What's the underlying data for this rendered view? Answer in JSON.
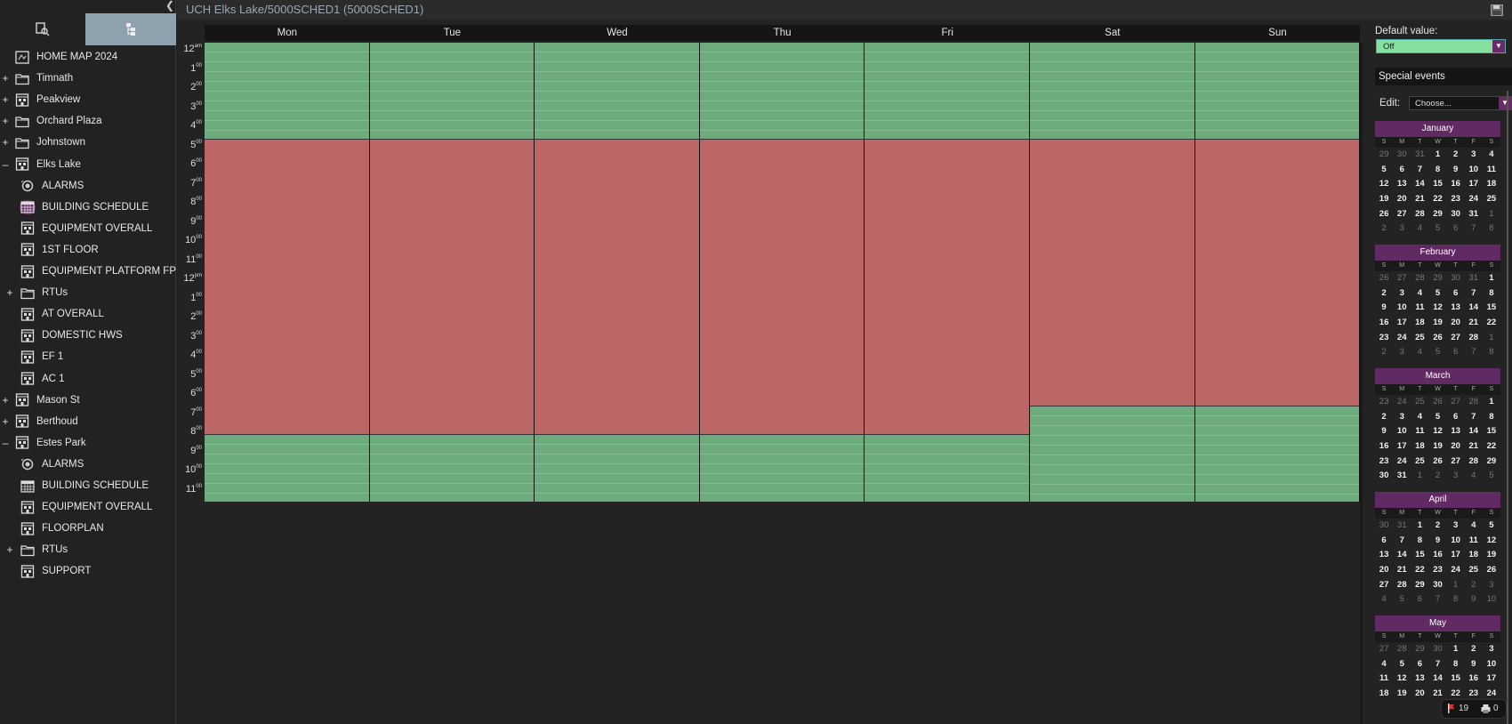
{
  "page_title": "UCH Elks Lake/5000SCHED1 (5000SCHED1)",
  "tree": [
    {
      "label": "HOME MAP 2024",
      "icon": "map-icon",
      "level": 0,
      "expander": ""
    },
    {
      "label": "Timnath",
      "icon": "folder-icon",
      "level": 0,
      "expander": "+"
    },
    {
      "label": "Peakview",
      "icon": "building-icon",
      "level": 0,
      "expander": "+"
    },
    {
      "label": "Orchard Plaza",
      "icon": "folder-icon",
      "level": 0,
      "expander": "+"
    },
    {
      "label": "Johnstown",
      "icon": "folder-icon",
      "level": 0,
      "expander": "+"
    },
    {
      "label": "Elks Lake",
      "icon": "building-icon",
      "level": 0,
      "expander": "–"
    },
    {
      "label": "ALARMS",
      "icon": "alarm-icon",
      "level": 1,
      "expander": ""
    },
    {
      "label": "BUILDING SCHEDULE",
      "icon": "calendar-icon",
      "level": 1,
      "expander": "",
      "selected": true
    },
    {
      "label": "EQUIPMENT OVERALL",
      "icon": "building-icon",
      "level": 1,
      "expander": ""
    },
    {
      "label": "1ST FLOOR",
      "icon": "building-icon",
      "level": 1,
      "expander": ""
    },
    {
      "label": "EQUIPMENT PLATFORM FP",
      "icon": "building-icon",
      "level": 1,
      "expander": ""
    },
    {
      "label": "RTUs",
      "icon": "folder-icon",
      "level": 1,
      "expander": "+"
    },
    {
      "label": "AT OVERALL",
      "icon": "building-icon",
      "level": 1,
      "expander": ""
    },
    {
      "label": "DOMESTIC HWS",
      "icon": "building-icon",
      "level": 1,
      "expander": ""
    },
    {
      "label": "EF 1",
      "icon": "building-icon",
      "level": 1,
      "expander": ""
    },
    {
      "label": "AC 1",
      "icon": "building-icon",
      "level": 1,
      "expander": ""
    },
    {
      "label": "Mason St",
      "icon": "building-icon",
      "level": 0,
      "expander": "+"
    },
    {
      "label": "Berthoud",
      "icon": "building-icon",
      "level": 0,
      "expander": "+"
    },
    {
      "label": "Estes Park",
      "icon": "building-icon",
      "level": 0,
      "expander": "–"
    },
    {
      "label": "ALARMS",
      "icon": "alarm-icon",
      "level": 1,
      "expander": ""
    },
    {
      "label": "BUILDING SCHEDULE",
      "icon": "calendar-icon",
      "level": 1,
      "expander": ""
    },
    {
      "label": "EQUIPMENT OVERALL",
      "icon": "building-icon",
      "level": 1,
      "expander": ""
    },
    {
      "label": "FLOORPLAN",
      "icon": "building-icon",
      "level": 1,
      "expander": ""
    },
    {
      "label": "RTUs",
      "icon": "folder-icon",
      "level": 1,
      "expander": "+"
    },
    {
      "label": "SUPPORT",
      "icon": "building-icon",
      "level": 1,
      "expander": ""
    }
  ],
  "schedule": {
    "days": [
      "Mon",
      "Tue",
      "Wed",
      "Thu",
      "Fri",
      "Sat",
      "Sun"
    ],
    "hours": [
      {
        "h": "12",
        "s": "am"
      },
      {
        "h": "1",
        "s": "00"
      },
      {
        "h": "2",
        "s": "00"
      },
      {
        "h": "3",
        "s": "00"
      },
      {
        "h": "4",
        "s": "00"
      },
      {
        "h": "5",
        "s": "00"
      },
      {
        "h": "6",
        "s": "00"
      },
      {
        "h": "7",
        "s": "00"
      },
      {
        "h": "8",
        "s": "00"
      },
      {
        "h": "9",
        "s": "00"
      },
      {
        "h": "10",
        "s": "00"
      },
      {
        "h": "11",
        "s": "00"
      },
      {
        "h": "12",
        "s": "pm"
      },
      {
        "h": "1",
        "s": "00"
      },
      {
        "h": "2",
        "s": "00"
      },
      {
        "h": "3",
        "s": "00"
      },
      {
        "h": "4",
        "s": "00"
      },
      {
        "h": "5",
        "s": "00"
      },
      {
        "h": "6",
        "s": "00"
      },
      {
        "h": "7",
        "s": "00"
      },
      {
        "h": "8",
        "s": "00"
      },
      {
        "h": "9",
        "s": "00"
      },
      {
        "h": "10",
        "s": "00"
      },
      {
        "h": "11",
        "s": "00"
      }
    ],
    "occupied": [
      {
        "day": "Mon",
        "start": 5,
        "end": 20.5
      },
      {
        "day": "Tue",
        "start": 5,
        "end": 20.5
      },
      {
        "day": "Wed",
        "start": 5,
        "end": 20.5
      },
      {
        "day": "Thu",
        "start": 5,
        "end": 20.5
      },
      {
        "day": "Fri",
        "start": 5,
        "end": 20.5
      },
      {
        "day": "Sat",
        "start": 5,
        "end": 19
      },
      {
        "day": "Sun",
        "start": 5,
        "end": 19
      }
    ],
    "colors": {
      "off": "#6eab7c",
      "on": "#bc6668"
    }
  },
  "right_panel": {
    "default_value_label": "Default value:",
    "default_value": "Off",
    "special_events_label": "Special events",
    "edit_label": "Edit:",
    "edit_placeholder": "Choose...",
    "dow": [
      "S",
      "M",
      "T",
      "W",
      "T",
      "F",
      "S"
    ],
    "months": [
      {
        "name": "January",
        "weeks": [
          [
            "29",
            "30",
            "31",
            "1",
            "2",
            "3",
            "4"
          ],
          [
            "5",
            "6",
            "7",
            "8",
            "9",
            "10",
            "11"
          ],
          [
            "12",
            "13",
            "14",
            "15",
            "16",
            "17",
            "18"
          ],
          [
            "19",
            "20",
            "21",
            "22",
            "23",
            "24",
            "25"
          ],
          [
            "26",
            "27",
            "28",
            "29",
            "30",
            "31",
            "1"
          ],
          [
            "2",
            "3",
            "4",
            "5",
            "6",
            "7",
            "8"
          ]
        ]
      },
      {
        "name": "February",
        "weeks": [
          [
            "26",
            "27",
            "28",
            "29",
            "30",
            "31",
            "1"
          ],
          [
            "2",
            "3",
            "4",
            "5",
            "6",
            "7",
            "8"
          ],
          [
            "9",
            "10",
            "11",
            "12",
            "13",
            "14",
            "15"
          ],
          [
            "16",
            "17",
            "18",
            "19",
            "20",
            "21",
            "22"
          ],
          [
            "23",
            "24",
            "25",
            "26",
            "27",
            "28",
            "1"
          ],
          [
            "2",
            "3",
            "4",
            "5",
            "6",
            "7",
            "8"
          ]
        ]
      },
      {
        "name": "March",
        "weeks": [
          [
            "23",
            "24",
            "25",
            "26",
            "27",
            "28",
            "1"
          ],
          [
            "2",
            "3",
            "4",
            "5",
            "6",
            "7",
            "8"
          ],
          [
            "9",
            "10",
            "11",
            "12",
            "13",
            "14",
            "15"
          ],
          [
            "16",
            "17",
            "18",
            "19",
            "20",
            "21",
            "22"
          ],
          [
            "23",
            "24",
            "25",
            "26",
            "27",
            "28",
            "29"
          ],
          [
            "30",
            "31",
            "1",
            "2",
            "3",
            "4",
            "5"
          ]
        ]
      },
      {
        "name": "April",
        "weeks": [
          [
            "30",
            "31",
            "1",
            "2",
            "3",
            "4",
            "5"
          ],
          [
            "6",
            "7",
            "8",
            "9",
            "10",
            "11",
            "12"
          ],
          [
            "13",
            "14",
            "15",
            "16",
            "17",
            "18",
            "19"
          ],
          [
            "20",
            "21",
            "22",
            "23",
            "24",
            "25",
            "26"
          ],
          [
            "27",
            "28",
            "29",
            "30",
            "1",
            "2",
            "3"
          ],
          [
            "4",
            "5",
            "6",
            "7",
            "8",
            "9",
            "10"
          ]
        ]
      },
      {
        "name": "May",
        "weeks": [
          [
            "27",
            "28",
            "29",
            "30",
            "1",
            "2",
            "3"
          ],
          [
            "4",
            "5",
            "6",
            "7",
            "8",
            "9",
            "10"
          ],
          [
            "11",
            "12",
            "13",
            "14",
            "15",
            "16",
            "17"
          ],
          [
            "18",
            "19",
            "20",
            "21",
            "22",
            "23",
            "24"
          ]
        ]
      }
    ]
  },
  "status": {
    "alarms": "19",
    "tasks": "0"
  }
}
